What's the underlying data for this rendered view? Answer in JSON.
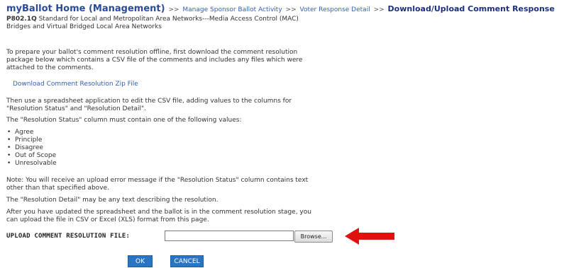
{
  "breadcrumb": {
    "home": "myBallot Home (Management)",
    "separator": ">>",
    "items": [
      "Manage Sponsor Ballot Activity",
      "Voter Response Detail"
    ],
    "current": "Download/Upload Comment Response"
  },
  "ballot": {
    "id": "P802.1Q",
    "title_line1": "Standard for Local and Metropolitan Area Networks---Media Access Control (MAC)",
    "title_line2": "Bridges and Virtual Bridged Local Area Networks"
  },
  "instructions": {
    "intro_1": "To prepare your ballot's comment resolution offline, first download the comment resolution",
    "intro_2": "package below which contains a CSV file of the comments and includes any files which were",
    "intro_3": "attached to the comments.",
    "download_link": "Download Comment Resolution Zip File",
    "edit_1": "Then use a spreadsheet application to edit the CSV file, adding values to the columns for",
    "edit_2": "\"Resolution Status\" and \"Resolution Detail\".",
    "status_intro": "The \"Resolution Status\" column must contain one of the following values:",
    "status_values": [
      "Agree",
      "Principle",
      "Disagree",
      "Out of Scope",
      "Unresolvable"
    ],
    "note_1": "Note: You will receive an upload error message if the \"Resolution Status\" column contains text",
    "note_2": "other than that specified above.",
    "detail": "The \"Resolution Detail\" may be any text describing the resolution.",
    "after_1": "After you have updated the spreadsheet and the ballot is in the comment resolution stage, you",
    "after_2": "can upload the file in CSV or Excel (XLS) format from this page."
  },
  "upload": {
    "label": "UPLOAD COMMENT RESOLUTION FILE:",
    "file_value": "",
    "browse_label": "Browse..."
  },
  "actions": {
    "ok_label": "OK",
    "cancel_label": "CANCEL"
  },
  "colors": {
    "link": "#3560b0",
    "button": "#2a74c4",
    "arrow": "#e0120f"
  },
  "icons": {
    "arrow": "red-arrow-left"
  }
}
